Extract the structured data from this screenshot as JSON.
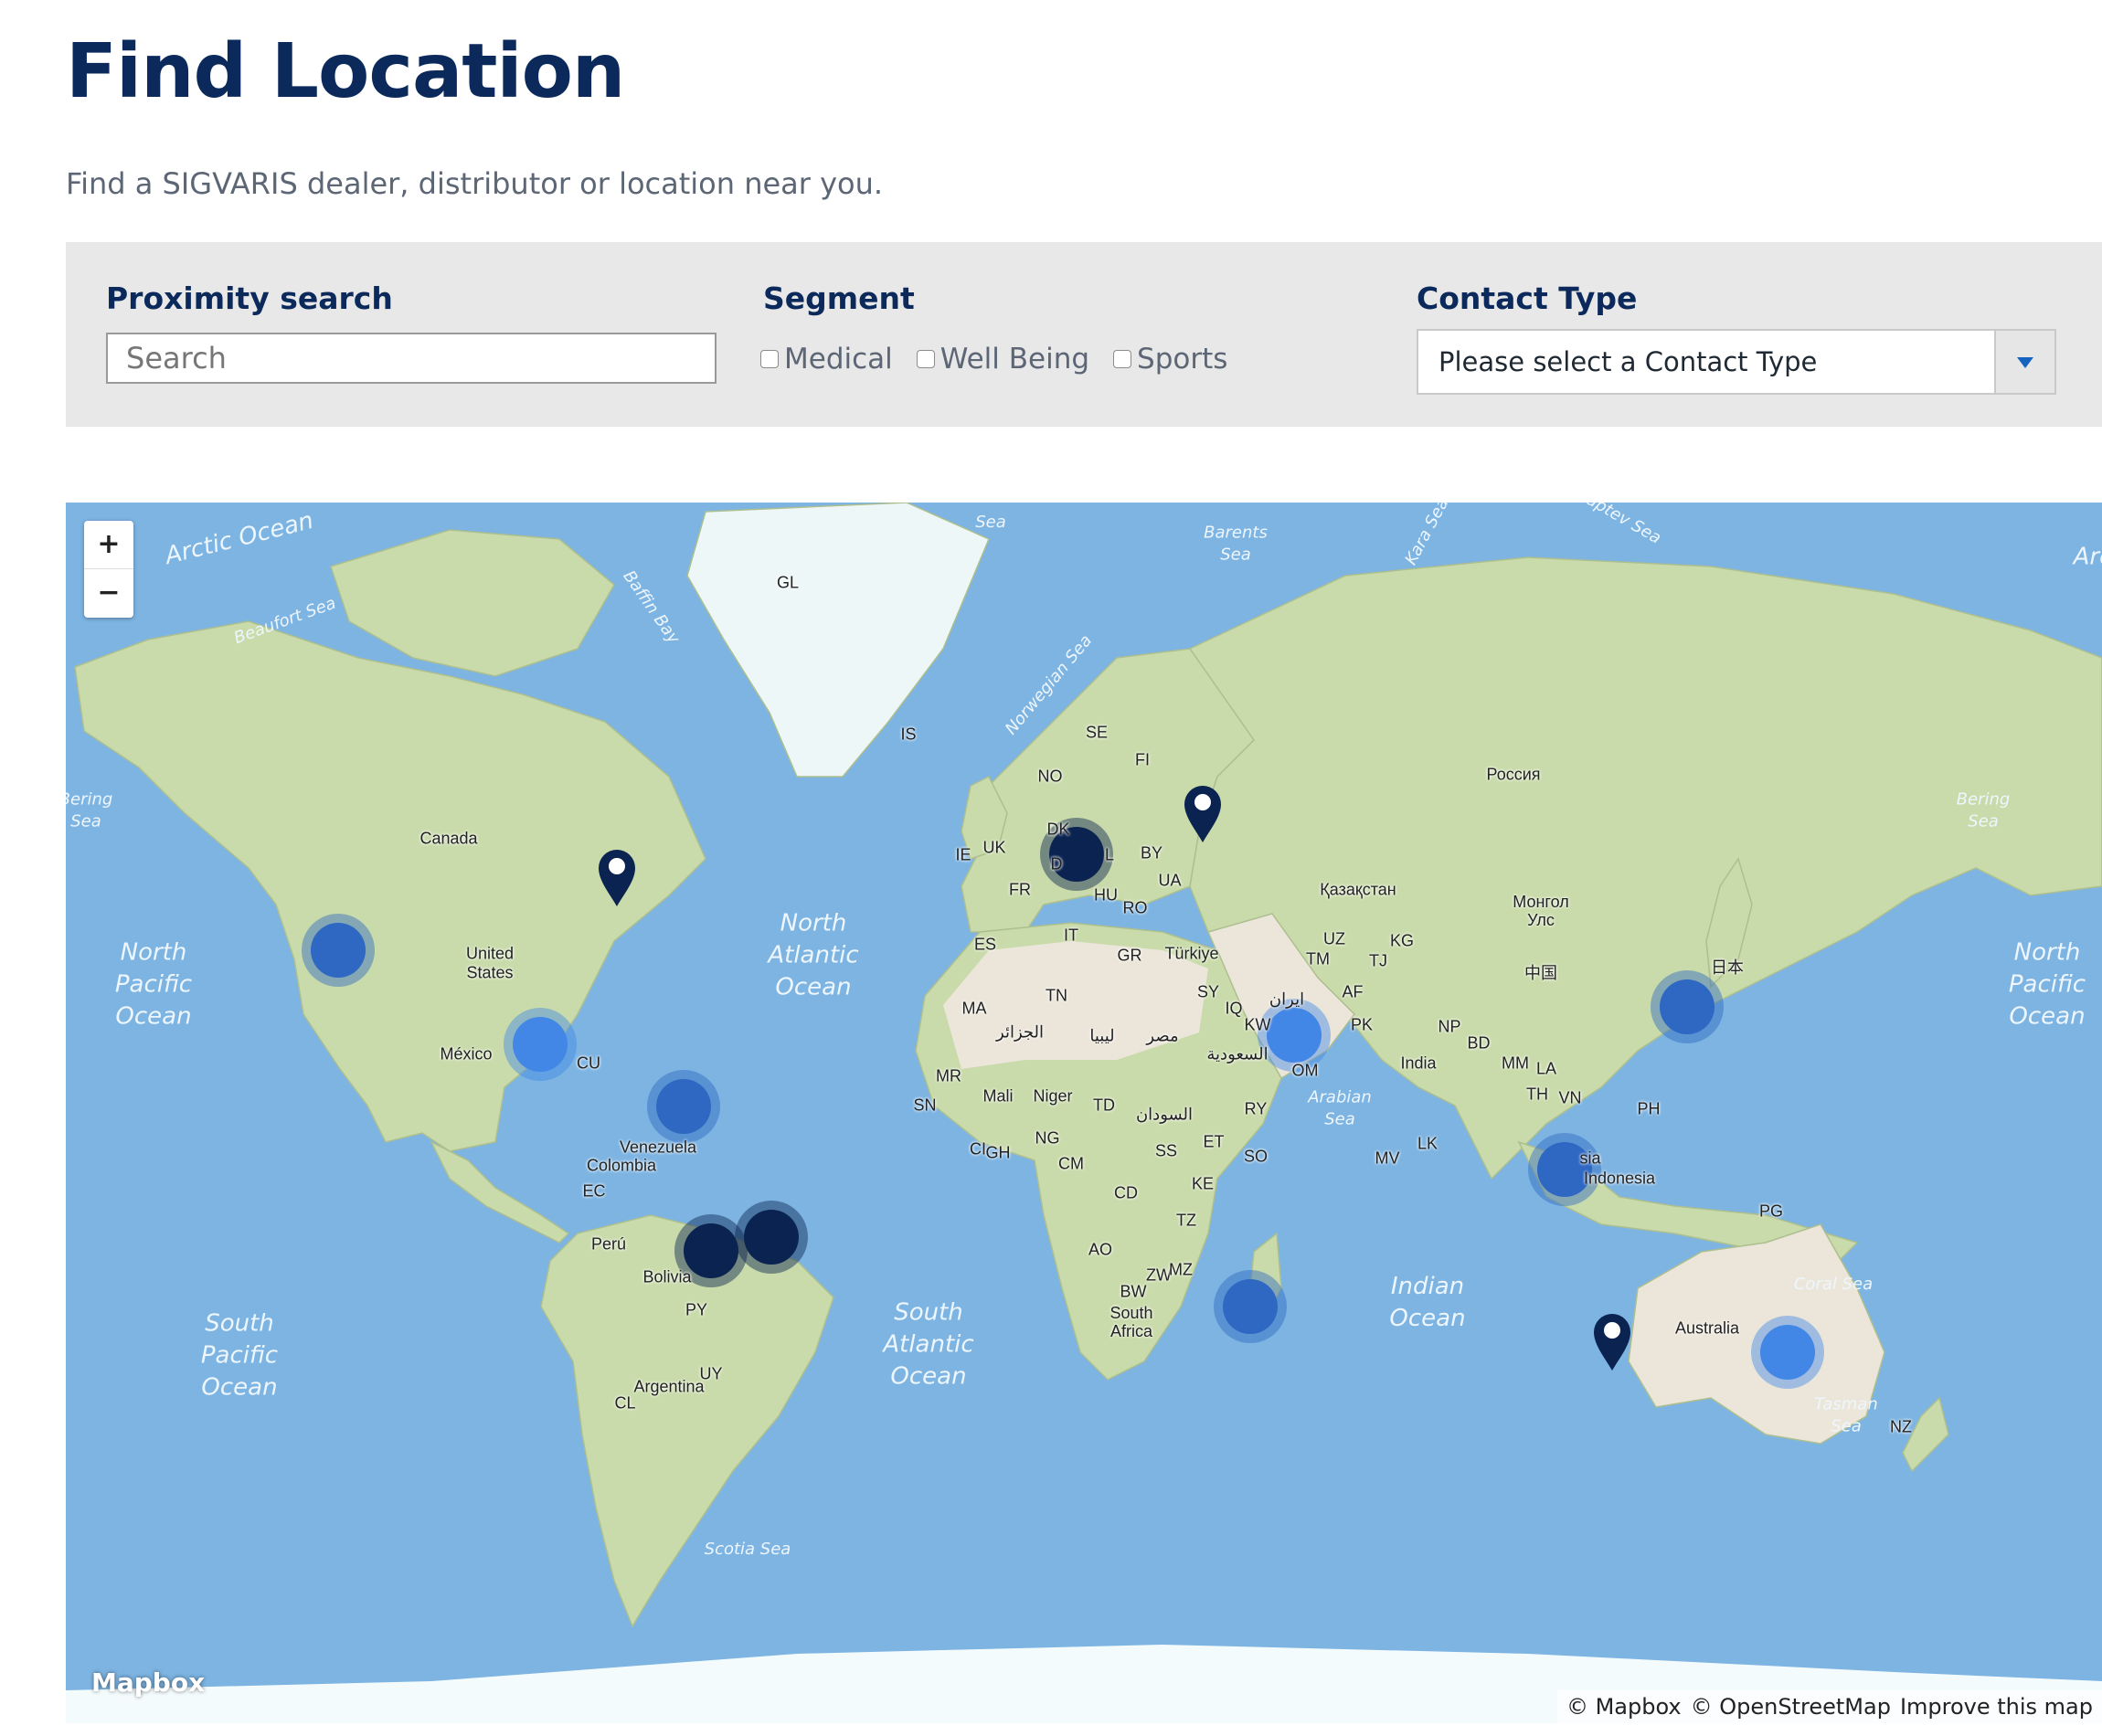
{
  "page": {
    "title": "Find Location",
    "subtitle": "Find a SIGVARIS dealer, distributor or location near you."
  },
  "filters": {
    "proximity_label": "Proximity search",
    "search_placeholder": "Search",
    "segment_label": "Segment",
    "segments": [
      {
        "label": "Medical",
        "checked": false
      },
      {
        "label": "Well Being",
        "checked": false
      },
      {
        "label": "Sports",
        "checked": false
      }
    ],
    "contact_type_label": "Contact Type",
    "contact_type_value": "Please select a Contact Type"
  },
  "map": {
    "zoom_in": "+",
    "zoom_out": "−",
    "logo": "Mapbox",
    "attribution": {
      "mapbox": "© Mapbox",
      "osm": "© OpenStreetMap",
      "improve": "Improve this map"
    },
    "colors": {
      "water": "#7db4e2",
      "land": "#c9dbaa",
      "cluster_dark": "#0a2350",
      "cluster_mid": "#2f68c2",
      "cluster_light": "#4287e6"
    },
    "ocean_labels": {
      "arctic": "Arctic Ocean",
      "arctic_right": "Arc",
      "north_pacific_left": "North\nPacific\nOcean",
      "north_pacific_right": "North\nPacific\nOcean",
      "north_atlantic": "North\nAtlantic\nOcean",
      "south_pacific": "South\nPacific\nOcean",
      "south_atlantic": "South\nAtlantic\nOcean",
      "indian": "Indian\nOcean",
      "beaufort": "Beaufort Sea",
      "baffin": "Baffin Bay",
      "bering_left": "Bering\nSea",
      "bering_right": "Bering\nSea",
      "norwegian": "Norwegian Sea",
      "barents": "Barents\nSea",
      "kara": "Kara Sea",
      "laptev": "Laptev Sea",
      "sea_top": "Sea",
      "arabian": "Arabian\nSea",
      "coral": "Coral Sea",
      "tasman": "Tasman\nSea",
      "scotia": "Scotia Sea"
    },
    "place_labels": {
      "gl": "GL",
      "is": "IS",
      "se": "SE",
      "fi": "FI",
      "no": "NO",
      "dk": "DK",
      "ie": "IE",
      "uk": "UK",
      "by": "BY",
      "ua": "UA",
      "fr": "FR",
      "hu": "HU",
      "ro": "RO",
      "it": "IT",
      "es": "ES",
      "gr": "GR",
      "turkiye": "Türkiye",
      "russia": "Россия",
      "kazakhstan": "Қазақстан",
      "mongolia": "Монгол\nУлс",
      "china": "中国",
      "japan": "日本",
      "uz": "UZ",
      "kg": "KG",
      "tm": "TM",
      "tj": "TJ",
      "af": "AF",
      "pk": "PK",
      "np": "NP",
      "bd": "BD",
      "india": "India",
      "mm": "MM",
      "la": "LA",
      "th": "TH",
      "vn": "VN",
      "ph": "PH",
      "lk": "LK",
      "mv": "MV",
      "indonesia": "Indonesia",
      "sia": "sia",
      "pg": "PG",
      "australia": "Australia",
      "nz": "NZ",
      "canada": "Canada",
      "united_states": "United\nStates",
      "mexico": "México",
      "cu": "CU",
      "venezuela": "Venezuela",
      "colombia": "Colombia",
      "ec": "EC",
      "peru": "Perú",
      "bolivia": "Bolivia",
      "py": "PY",
      "uy": "UY",
      "argentina": "Argentina",
      "cl": "CL",
      "ma": "MA",
      "algeria": "الجزائر",
      "libya": "ليبيا",
      "egypt": "مصر",
      "tn": "TN",
      "sy": "SY",
      "iq": "IQ",
      "kw": "KW",
      "saudi": "السعودية",
      "om": "OM",
      "ye": "RY",
      "mr": "MR",
      "mali": "Mali",
      "niger": "Niger",
      "td": "TD",
      "sudan": "السودان",
      "sn": "SN",
      "ci": "CI",
      "gh": "GH",
      "ng": "NG",
      "cm": "CM",
      "ss": "SS",
      "et": "ET",
      "so": "SO",
      "ke": "KE",
      "cd": "CD",
      "tz": "TZ",
      "ao": "AO",
      "zw": "ZW",
      "mz": "MZ",
      "bw": "BW",
      "south_africa": "South\nAfrica",
      "iran": "ایران",
      "de": "D",
      "pl": "L"
    }
  }
}
